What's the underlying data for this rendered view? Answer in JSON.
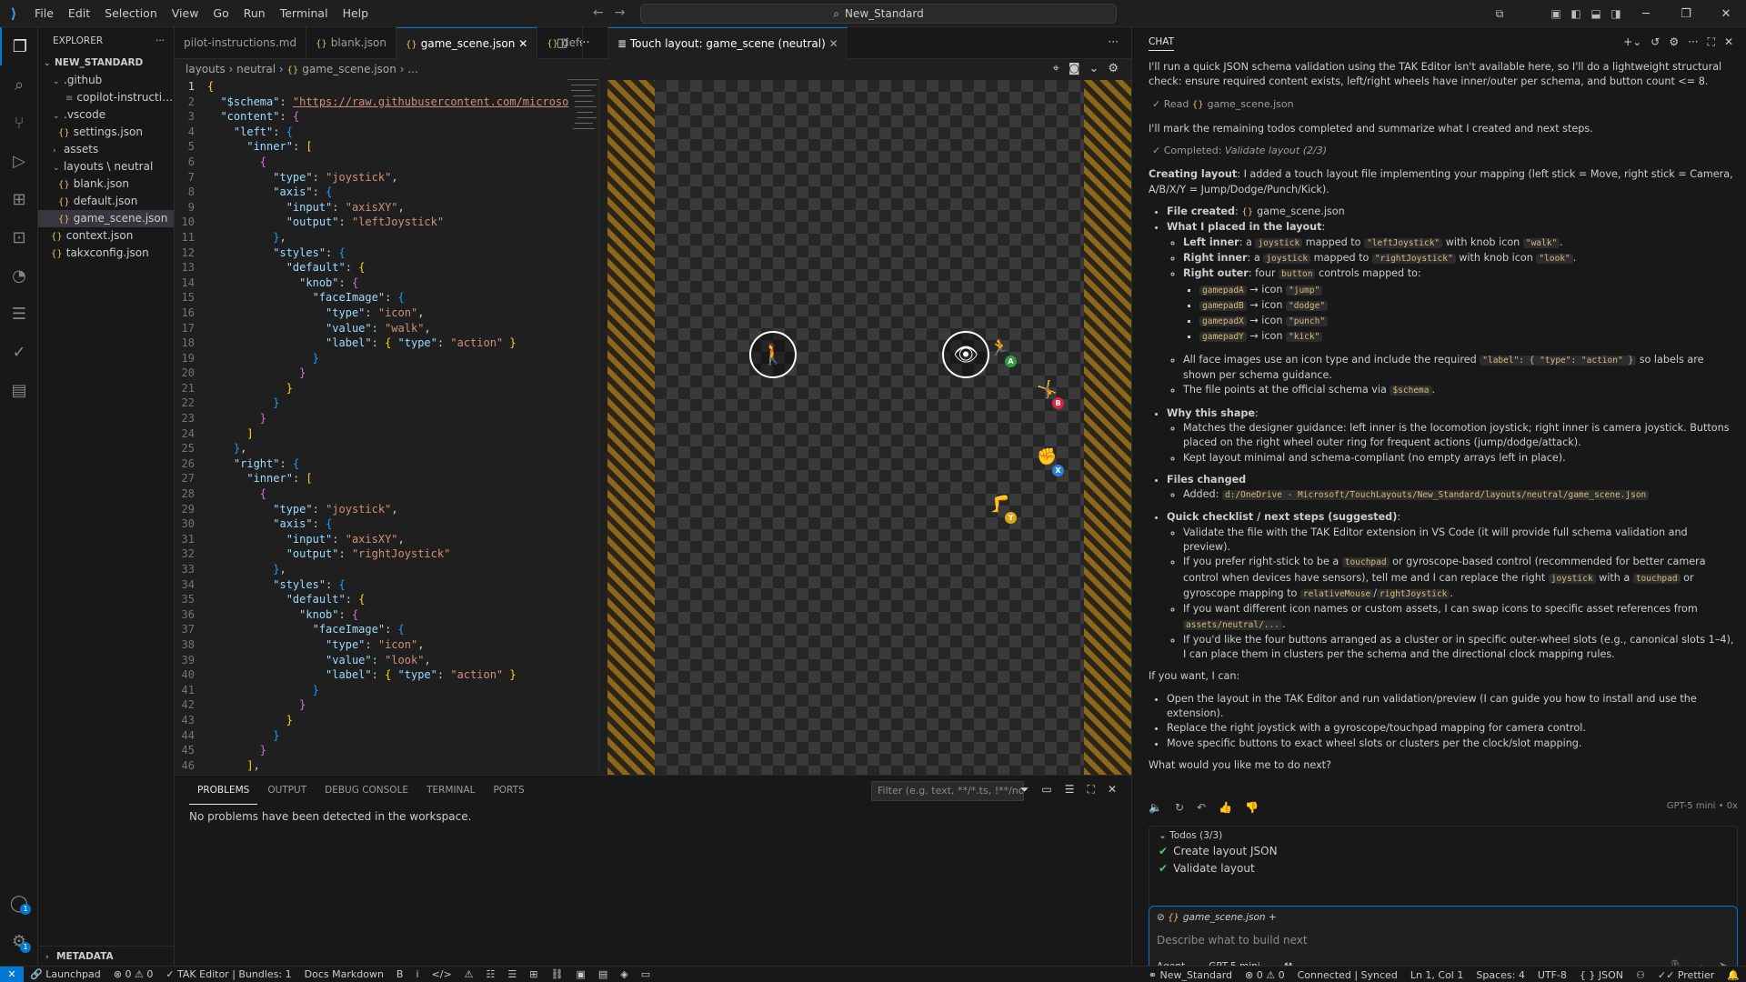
{
  "app": {
    "search_text": "New_Standard",
    "menu": [
      "File",
      "Edit",
      "Selection",
      "View",
      "Go",
      "Run",
      "Terminal",
      "Help"
    ]
  },
  "explorer": {
    "header": "EXPLORER",
    "root": "NEW_STANDARD",
    "items": [
      {
        "label": ".github",
        "kind": "folder-open",
        "indent": 1
      },
      {
        "label": "copilot-instructions....",
        "kind": "md",
        "indent": 2
      },
      {
        "label": ".vscode",
        "kind": "folder-open",
        "indent": 1
      },
      {
        "label": "settings.json",
        "kind": "json",
        "indent": 2
      },
      {
        "label": "assets",
        "kind": "folder",
        "indent": 1
      },
      {
        "label": "layouts \\ neutral",
        "kind": "folder-open",
        "indent": 1
      },
      {
        "label": "blank.json",
        "kind": "json",
        "indent": 2
      },
      {
        "label": "default.json",
        "kind": "json",
        "indent": 2
      },
      {
        "label": "game_scene.json",
        "kind": "json",
        "indent": 2,
        "selected": true
      },
      {
        "label": "context.json",
        "kind": "json",
        "indent": 1
      },
      {
        "label": "takxconfig.json",
        "kind": "json",
        "indent": 1
      }
    ],
    "metadata": "METADATA"
  },
  "editor": {
    "tabs": [
      "pilot-instructions.md",
      "blank.json",
      "game_scene.json",
      "defa"
    ],
    "active_tab": "game_scene.json",
    "breadcrumb": [
      "layouts",
      "neutral",
      "game_scene.json",
      "..."
    ],
    "lines": [
      [
        [
          "b1",
          "{"
        ]
      ],
      [
        [
          "p",
          "  "
        ],
        [
          "k",
          "\"$schema\""
        ],
        [
          "p",
          ": "
        ],
        [
          "lnk",
          "\"https://raw.githubusercontent.com/microso"
        ]
      ],
      [
        [
          "p",
          "  "
        ],
        [
          "k",
          "\"content\""
        ],
        [
          "p",
          ": "
        ],
        [
          "b2",
          "{"
        ]
      ],
      [
        [
          "p",
          "    "
        ],
        [
          "k",
          "\"left\""
        ],
        [
          "p",
          ": "
        ],
        [
          "b3",
          "{"
        ]
      ],
      [
        [
          "p",
          "      "
        ],
        [
          "k",
          "\"inner\""
        ],
        [
          "p",
          ": "
        ],
        [
          "b1",
          "["
        ]
      ],
      [
        [
          "p",
          "        "
        ],
        [
          "b2",
          "{"
        ]
      ],
      [
        [
          "p",
          "          "
        ],
        [
          "k",
          "\"type\""
        ],
        [
          "p",
          ": "
        ],
        [
          "s",
          "\"joystick\""
        ],
        [
          "p",
          ","
        ]
      ],
      [
        [
          "p",
          "          "
        ],
        [
          "k",
          "\"axis\""
        ],
        [
          "p",
          ": "
        ],
        [
          "b3",
          "{"
        ]
      ],
      [
        [
          "p",
          "            "
        ],
        [
          "k",
          "\"input\""
        ],
        [
          "p",
          ": "
        ],
        [
          "s",
          "\"axisXY\""
        ],
        [
          "p",
          ","
        ]
      ],
      [
        [
          "p",
          "            "
        ],
        [
          "k",
          "\"output\""
        ],
        [
          "p",
          ": "
        ],
        [
          "s",
          "\"leftJoystick\""
        ]
      ],
      [
        [
          "p",
          "          "
        ],
        [
          "b3",
          "}"
        ],
        [
          "p",
          ","
        ]
      ],
      [
        [
          "p",
          "          "
        ],
        [
          "k",
          "\"styles\""
        ],
        [
          "p",
          ": "
        ],
        [
          "b3",
          "{"
        ]
      ],
      [
        [
          "p",
          "            "
        ],
        [
          "k",
          "\"default\""
        ],
        [
          "p",
          ": "
        ],
        [
          "b1",
          "{"
        ]
      ],
      [
        [
          "p",
          "              "
        ],
        [
          "k",
          "\"knob\""
        ],
        [
          "p",
          ": "
        ],
        [
          "b2",
          "{"
        ]
      ],
      [
        [
          "p",
          "                "
        ],
        [
          "k",
          "\"faceImage\""
        ],
        [
          "p",
          ": "
        ],
        [
          "b3",
          "{"
        ]
      ],
      [
        [
          "p",
          "                  "
        ],
        [
          "k",
          "\"type\""
        ],
        [
          "p",
          ": "
        ],
        [
          "s",
          "\"icon\""
        ],
        [
          "p",
          ","
        ]
      ],
      [
        [
          "p",
          "                  "
        ],
        [
          "k",
          "\"value\""
        ],
        [
          "p",
          ": "
        ],
        [
          "s",
          "\"walk\""
        ],
        [
          "p",
          ","
        ]
      ],
      [
        [
          "p",
          "                  "
        ],
        [
          "k",
          "\"label\""
        ],
        [
          "p",
          ": "
        ],
        [
          "b1",
          "{ "
        ],
        [
          "k",
          "\"type\""
        ],
        [
          "p",
          ": "
        ],
        [
          "s",
          "\"action\""
        ],
        [
          "b1",
          " }"
        ]
      ],
      [
        [
          "p",
          "                "
        ],
        [
          "b3",
          "}"
        ]
      ],
      [
        [
          "p",
          "              "
        ],
        [
          "b2",
          "}"
        ]
      ],
      [
        [
          "p",
          "            "
        ],
        [
          "b1",
          "}"
        ]
      ],
      [
        [
          "p",
          "          "
        ],
        [
          "b3",
          "}"
        ]
      ],
      [
        [
          "p",
          "        "
        ],
        [
          "b2",
          "}"
        ]
      ],
      [
        [
          "p",
          "      "
        ],
        [
          "b1",
          "]"
        ]
      ],
      [
        [
          "p",
          "    "
        ],
        [
          "b3",
          "}"
        ],
        [
          "p",
          ","
        ]
      ],
      [
        [
          "p",
          "    "
        ],
        [
          "k",
          "\"right\""
        ],
        [
          "p",
          ": "
        ],
        [
          "b3",
          "{"
        ]
      ],
      [
        [
          "p",
          "      "
        ],
        [
          "k",
          "\"inner\""
        ],
        [
          "p",
          ": "
        ],
        [
          "b1",
          "["
        ]
      ],
      [
        [
          "p",
          "        "
        ],
        [
          "b2",
          "{"
        ]
      ],
      [
        [
          "p",
          "          "
        ],
        [
          "k",
          "\"type\""
        ],
        [
          "p",
          ": "
        ],
        [
          "s",
          "\"joystick\""
        ],
        [
          "p",
          ","
        ]
      ],
      [
        [
          "p",
          "          "
        ],
        [
          "k",
          "\"axis\""
        ],
        [
          "p",
          ": "
        ],
        [
          "b3",
          "{"
        ]
      ],
      [
        [
          "p",
          "            "
        ],
        [
          "k",
          "\"input\""
        ],
        [
          "p",
          ": "
        ],
        [
          "s",
          "\"axisXY\""
        ],
        [
          "p",
          ","
        ]
      ],
      [
        [
          "p",
          "            "
        ],
        [
          "k",
          "\"output\""
        ],
        [
          "p",
          ": "
        ],
        [
          "s",
          "\"rightJoystick\""
        ]
      ],
      [
        [
          "p",
          "          "
        ],
        [
          "b3",
          "}"
        ],
        [
          "p",
          ","
        ]
      ],
      [
        [
          "p",
          "          "
        ],
        [
          "k",
          "\"styles\""
        ],
        [
          "p",
          ": "
        ],
        [
          "b3",
          "{"
        ]
      ],
      [
        [
          "p",
          "            "
        ],
        [
          "k",
          "\"default\""
        ],
        [
          "p",
          ": "
        ],
        [
          "b1",
          "{"
        ]
      ],
      [
        [
          "p",
          "              "
        ],
        [
          "k",
          "\"knob\""
        ],
        [
          "p",
          ": "
        ],
        [
          "b2",
          "{"
        ]
      ],
      [
        [
          "p",
          "                "
        ],
        [
          "k",
          "\"faceImage\""
        ],
        [
          "p",
          ": "
        ],
        [
          "b3",
          "{"
        ]
      ],
      [
        [
          "p",
          "                  "
        ],
        [
          "k",
          "\"type\""
        ],
        [
          "p",
          ": "
        ],
        [
          "s",
          "\"icon\""
        ],
        [
          "p",
          ","
        ]
      ],
      [
        [
          "p",
          "                  "
        ],
        [
          "k",
          "\"value\""
        ],
        [
          "p",
          ": "
        ],
        [
          "s",
          "\"look\""
        ],
        [
          "p",
          ","
        ]
      ],
      [
        [
          "p",
          "                  "
        ],
        [
          "k",
          "\"label\""
        ],
        [
          "p",
          ": "
        ],
        [
          "b1",
          "{ "
        ],
        [
          "k",
          "\"type\""
        ],
        [
          "p",
          ": "
        ],
        [
          "s",
          "\"action\""
        ],
        [
          "b1",
          " }"
        ]
      ],
      [
        [
          "p",
          "                "
        ],
        [
          "b3",
          "}"
        ]
      ],
      [
        [
          "p",
          "              "
        ],
        [
          "b2",
          "}"
        ]
      ],
      [
        [
          "p",
          "            "
        ],
        [
          "b1",
          "}"
        ]
      ],
      [
        [
          "p",
          "          "
        ],
        [
          "b3",
          "}"
        ]
      ],
      [
        [
          "p",
          "        "
        ],
        [
          "b2",
          "}"
        ]
      ],
      [
        [
          "p",
          "      "
        ],
        [
          "b1",
          "]"
        ],
        [
          "p",
          ","
        ]
      ],
      [
        [
          "p",
          "      "
        ],
        [
          "k",
          "\"outer\""
        ],
        [
          "p",
          ": "
        ],
        [
          "b1",
          "["
        ]
      ]
    ]
  },
  "preview": {
    "tab": "Touch layout: game_scene (neutral)",
    "wheels": [
      {
        "name": "left-joystick-walk",
        "icon": "🚶"
      },
      {
        "name": "right-joystick-look",
        "icon": "👁"
      }
    ],
    "buttons": [
      {
        "name": "gamepadA-jump",
        "icon": "🏃",
        "label": "A",
        "color": "#2e9e3e"
      },
      {
        "name": "gamepadB-dodge",
        "icon": "🤸",
        "label": "B",
        "color": "#d7263d"
      },
      {
        "name": "gamepadX-punch",
        "icon": "✊",
        "label": "X",
        "color": "#2f7fd6"
      },
      {
        "name": "gamepadY-kick",
        "icon": "🦵",
        "label": "Y",
        "color": "#e0a512"
      }
    ]
  },
  "panel": {
    "tabs": [
      "PROBLEMS",
      "OUTPUT",
      "DEBUG CONSOLE",
      "TERMINAL",
      "PORTS"
    ],
    "active": "PROBLEMS",
    "filter_placeholder": "Filter (e.g. text, **/*.ts, !**/nod...",
    "message": "No problems have been detected in the workspace."
  },
  "chat": {
    "title": "CHAT",
    "intro": "I'll run a quick JSON schema validation using the TAK Editor isn't available here, so I'll do a lightweight structural check: ensure required content exists, left/right wheels have inner/outer per schema, and button count <= 8.",
    "read_step": "Read",
    "read_file": "game_scene.json",
    "mark": "I'll mark the remaining todos completed and summarize what I created and next steps.",
    "completed": "Completed:",
    "completed_task": "Validate layout (2/3)",
    "creating_bold": "Creating layout",
    "creating_rest": ": I added a touch layout file implementing your mapping (left stick = Move, right stick = Camera, A/B/X/Y = Jump/Dodge/Punch/Kick).",
    "file_created_label": "File created",
    "file_created": "game_scene.json",
    "what_placed": "What I placed in the layout",
    "left_inner": "Left inner",
    "right_inner": "Right inner",
    "right_outer": "Right outer",
    "right_outer_text": ": four",
    "right_outer_text2": "controls mapped to:",
    "code_joystick": "joystick",
    "code_button": "button",
    "code_left": "\"leftJoystick\"",
    "code_right": "\"rightJoystick\"",
    "code_walk": "\"walk\"",
    "code_look": "\"look\"",
    "mapped_to": "mapped to",
    "with_knob": "with knob icon",
    "a_word": ": a",
    "arrow_icon": "→ icon",
    "mappings": [
      {
        "btn": "gamepadA",
        "icon": "\"jump\""
      },
      {
        "btn": "gamepadB",
        "icon": "\"dodge\""
      },
      {
        "btn": "gamepadX",
        "icon": "\"punch\""
      },
      {
        "btn": "gamepadY",
        "icon": "\"kick\""
      }
    ],
    "face_images": "All face images use an icon type and include the required",
    "label_code": "\"label\": { \"type\": \"action\" }",
    "face_images_2": "so labels are shown per schema guidance.",
    "schema_point": "The file points at the official schema via",
    "schema_code": "$schema",
    "why": "Why this shape",
    "why_1": "Matches the designer guidance: left inner is the locomotion joystick; right inner is camera joystick. Buttons placed on the right wheel outer ring for frequent actions (jump/dodge/attack).",
    "why_2": "Kept layout minimal and schema-compliant (no empty arrays left in place).",
    "files_changed": "Files changed",
    "added": "Added:",
    "added_path": "d:/OneDrive - Microsoft/TouchLayouts/New_Standard/layouts/neutral/game_scene.json",
    "checklist": "Quick checklist / next steps (suggested)",
    "check_1": "Validate the file with the TAK Editor extension in VS Code (it will provide full schema validation and preview).",
    "check_2a": "If you prefer right-stick to be a",
    "code_touchpad": "touchpad",
    "check_2b": "or gyroscope-based control (recommended for better camera control when devices have sensors), tell me and I can replace the right",
    "check_2c": "with a",
    "check_2d": "or gyroscope mapping to",
    "code_relmouse": "relativeMouse",
    "code_rightjoy": "rightJoystick",
    "check_3a": "If you want different icon names or custom assets, I can swap icons to specific asset references from",
    "code_assets": "assets/neutral/...",
    "check_4": "If you'd like the four buttons arranged as a cluster or in specific outer-wheel slots (e.g., canonical slots 1–4), I can place them in clusters per the schema and the directional clock mapping rules.",
    "if_you_want": "If you want, I can:",
    "can_1": "Open the layout in the TAK Editor and run validation/preview (I can guide you how to install and use the extension).",
    "can_2": "Replace the right joystick with a gyroscope/touchpad mapping for camera control.",
    "can_3": "Move specific buttons to exact wheel slots or clusters per the clock/slot mapping.",
    "question": "What would you like me to do next?",
    "model_note": "GPT-5 mini • 0x",
    "todos_header": "Todos (3/3)",
    "todos": [
      "Create layout JSON",
      "Validate layout",
      "Finalize and report"
    ],
    "context_file": "game_scene.json",
    "input_placeholder": "Describe what to build next",
    "mode": "Agent",
    "model": "GPT-5 mini"
  },
  "status": {
    "left": [
      "Launchpad",
      "0",
      "0",
      "0",
      "TAK Editor | Bundles: 1",
      "Docs Markdown",
      "B",
      "i"
    ],
    "right": [
      "New_Standard",
      "0",
      "0",
      "Connected | Synced",
      "Ln 1, Col 1",
      "Spaces: 4",
      "UTF-8",
      "{ } JSON",
      "Prettier"
    ]
  }
}
